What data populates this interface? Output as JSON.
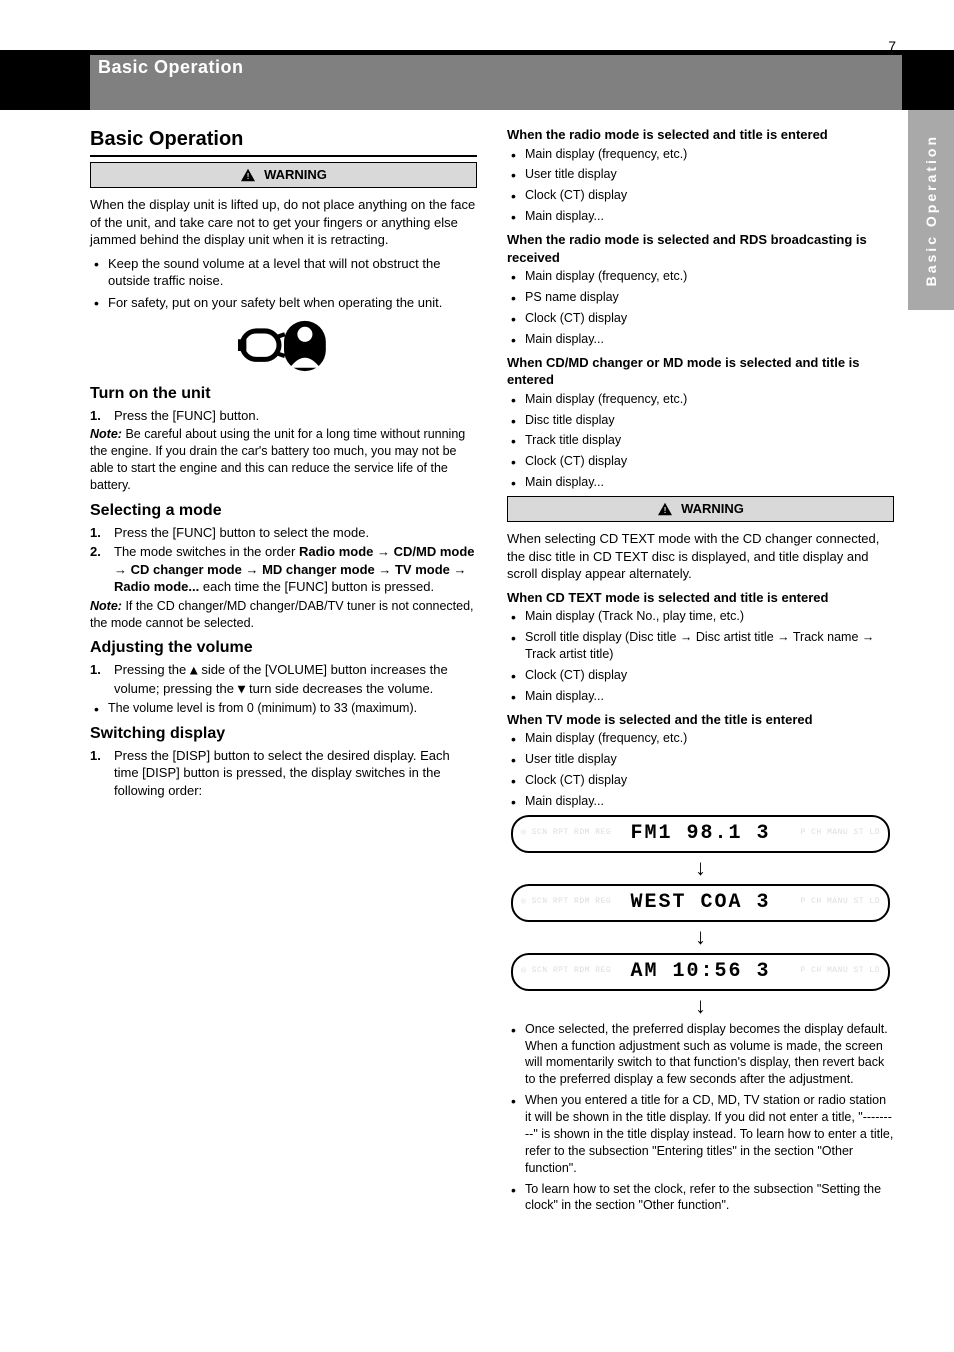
{
  "header": {
    "title": "Basic Operation"
  },
  "side_tab": {
    "label": "Basic Operation"
  },
  "left": {
    "h2": "Basic Operation",
    "warning_label": "WARNING",
    "warn_p1": "When the display unit is lifted up, do not place anything on the face of the unit, and take care not to get your fingers or anything else jammed behind the display unit when it is retracting.",
    "warn_b1": "Keep the sound volume at a level that will not obstruct the outside traffic noise.",
    "warn_b2": "For safety, put on your safety belt when operating the unit.",
    "h3_on": "Turn on the unit",
    "on_step1_num": "1.",
    "on_step1_text": "Press the [FUNC] button.",
    "on_note_label": "Note:",
    "on_note_text": "Be careful about using the unit for a long time without running the engine. If you drain the car's battery too much, you may not be able to start the engine and this can reduce the service life of the battery.",
    "h3_mode": "Selecting a mode",
    "mode_step1_num": "1.",
    "mode_step1_text": "Press the [FUNC] button to select the mode.",
    "mode_step2_num": "2.",
    "mode_step2_text": "The mode switches in the order",
    "mode_step2_b": "Radio mode → CD/MD mode → CD changer mode → MD changer mode → TV mode → Radio mode...",
    "mode_step2_c": " each time the [FUNC] button is pressed.",
    "mode_note_label": "Note:",
    "mode_note_text": "If the CD changer/MD changer/DAB/TV tuner is not connected, the mode cannot be selected.",
    "h3_vol": "Adjusting the volume",
    "vol_step1_num": "1.",
    "vol_step1_text_a": "Pressing the ",
    "vol_step1_text_b": " side of the [VOLUME] button increases the volume; pressing the ",
    "vol_step1_text_c": " turn side decreases the volume.",
    "vol_b1": "The volume level is from 0 (minimum) to 33 (maximum).",
    "h3_disp": "Switching display",
    "disp_step1_num": "1.",
    "disp_step1_text": "Press the [DISP] button to select the desired display. Each time [DISP] button is pressed, the display switches in the following order:"
  },
  "right": {
    "h4_radio": "When the radio mode is selected and title is entered",
    "radio_list": [
      "Main display (frequency, etc.)",
      "User title display",
      "Clock (CT) display",
      "Main display..."
    ],
    "h4_rds": "When the radio mode is selected and RDS broadcasting is received",
    "rds_list": [
      "Main display (frequency, etc.)",
      "PS name display",
      "Clock (CT) display",
      "Main display..."
    ],
    "h4_cd": "When CD/MD changer or MD mode is selected and title is entered",
    "cd_list": [
      "Main display (frequency, etc.)",
      "Disc title display",
      "Track title display",
      "Clock (CT) display",
      "Main display..."
    ],
    "warning_label": "WARNING",
    "warn_text": "When selecting CD TEXT mode with the CD changer connected, the disc title in CD TEXT disc is displayed, and title display and scroll display appear alternately.",
    "h4_cdtext": "When CD TEXT mode is selected and title is entered",
    "cdtext_list": [
      "Main display (Track No., play time, etc.)",
      "Scroll title display (Disc title → Disc artist title → Track name → Track artist title)",
      "Clock (CT) display",
      "Main display..."
    ],
    "h4_tv": "When TV mode is selected and the title is entered",
    "tv_list": [
      "Main display (frequency, etc.)",
      "User title display",
      "Clock (CT) display",
      "Main display..."
    ],
    "lcd": [
      {
        "text": "FM1  98.1  3"
      },
      {
        "text": "WEST  COA 3"
      },
      {
        "text": "AM    10:56 3"
      }
    ],
    "b1": "Once selected, the preferred display becomes the display default. When a function adjustment such as volume is made, the screen will momentarily switch to that function's display, then revert back to the preferred display a few seconds after the adjustment.",
    "b2": "When you entered a title for a CD, MD, TV station or radio station it will be shown in the title display. If you did not enter a title, \"---------\" is shown in the title display instead. To learn how to enter a title, refer to the subsection \"Entering titles\" in the section \"Other function\".",
    "b3": "To learn how to set the clock, refer to the subsection \"Setting the clock\" in the section \"Other function\"."
  },
  "page_number": "7"
}
